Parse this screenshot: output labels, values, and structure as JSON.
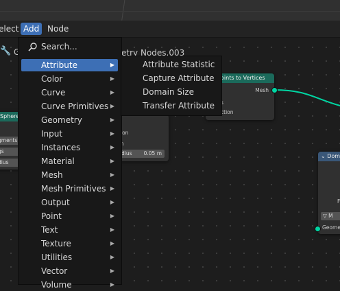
{
  "header": {
    "menus": [
      "elect",
      "Add",
      "Node"
    ],
    "active_menu": "Add"
  },
  "editor": {
    "left_label": "G",
    "tree_name": "ometry Nodes.003"
  },
  "nodes": {
    "sphere": {
      "title": "Sphere",
      "rows": [
        "gments",
        "gs",
        "dius"
      ]
    },
    "mid": {
      "rows": [
        "ion",
        "n",
        "dius"
      ],
      "radius_value": "0.05 m"
    },
    "points_to_vertices": {
      "title": "oints to Vertices",
      "output": "Mesh",
      "rows": [
        "s",
        "ction"
      ]
    },
    "domain": {
      "title": "Dom",
      "rows": [
        "F",
        "M",
        "Geome"
      ]
    }
  },
  "add_menu": {
    "search_label": "Search...",
    "items": [
      {
        "label": "Attribute",
        "has_submenu": true,
        "highlighted": true
      },
      {
        "label": "Color",
        "has_submenu": true
      },
      {
        "label": "Curve",
        "has_submenu": true
      },
      {
        "label": "Curve Primitives",
        "has_submenu": true
      },
      {
        "label": "Geometry",
        "has_submenu": true
      },
      {
        "label": "Input",
        "has_submenu": true
      },
      {
        "label": "Instances",
        "has_submenu": true
      },
      {
        "label": "Material",
        "has_submenu": true
      },
      {
        "label": "Mesh",
        "has_submenu": true
      },
      {
        "label": "Mesh Primitives",
        "has_submenu": true
      },
      {
        "label": "Output",
        "has_submenu": true
      },
      {
        "label": "Point",
        "has_submenu": true
      },
      {
        "label": "Text",
        "has_submenu": true
      },
      {
        "label": "Texture",
        "has_submenu": true
      },
      {
        "label": "Utilities",
        "has_submenu": true
      },
      {
        "label": "Vector",
        "has_submenu": true
      },
      {
        "label": "Volume",
        "has_submenu": true
      }
    ]
  },
  "attribute_submenu": {
    "items": [
      "Attribute Statistic",
      "Capture Attribute",
      "Domain Size",
      "Transfer Attribute"
    ]
  },
  "colors": {
    "accent": "#3d6fb5",
    "geometry_socket": "#00d6a3",
    "node_header_geometry": "#1b6a5b",
    "node_header_input": "#3a5778"
  },
  "glyphs": {
    "arrow": "▶",
    "chevron": "⌄",
    "wrench": "🔧"
  }
}
